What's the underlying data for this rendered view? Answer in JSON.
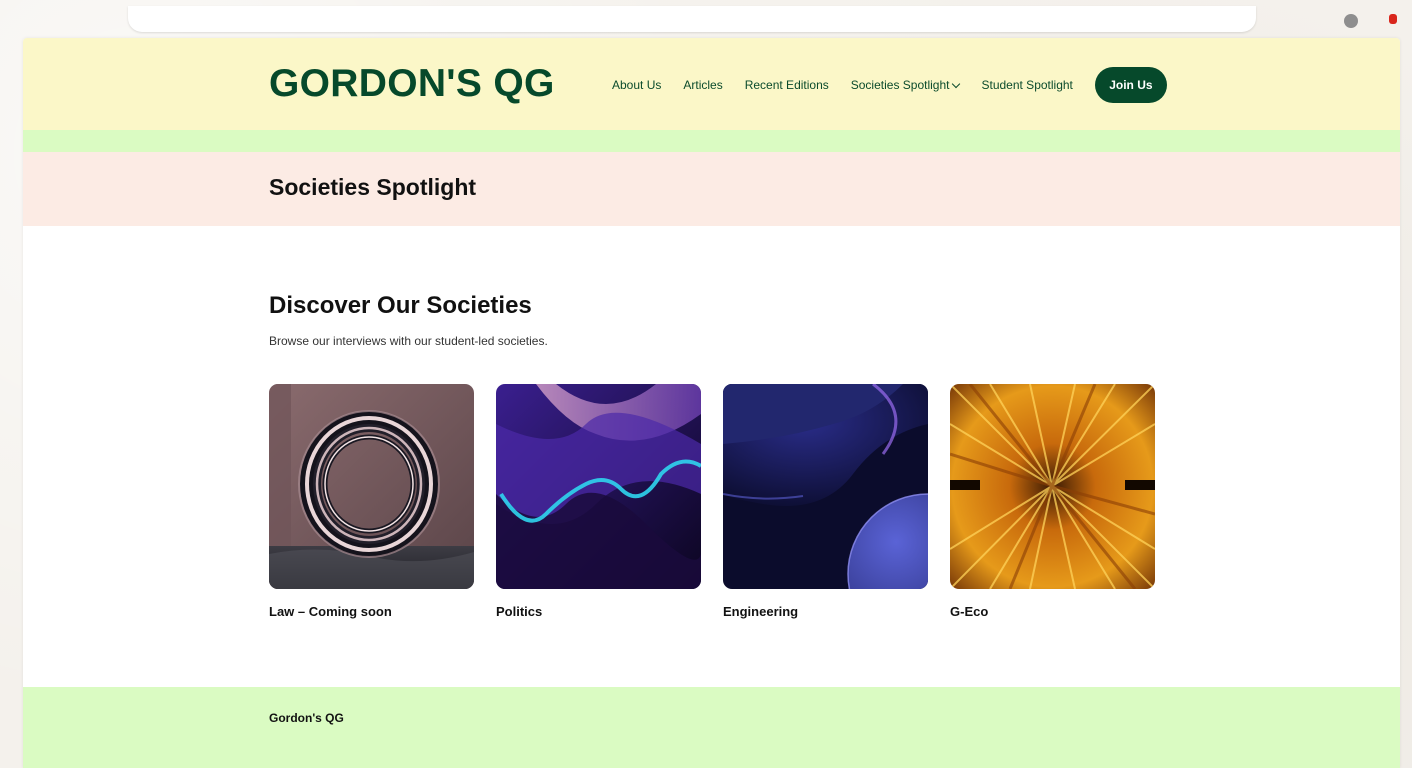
{
  "header": {
    "logo": "GORDON'S QG",
    "nav": [
      {
        "label": "About Us"
      },
      {
        "label": "Articles"
      },
      {
        "label": "Recent Editions"
      },
      {
        "label": "Societies Spotlight"
      },
      {
        "label": "Student Spotlight"
      }
    ],
    "cta_label": "Join Us"
  },
  "page_title": "Societies Spotlight",
  "section": {
    "title": "Discover Our Societies",
    "subtitle": "Browse our interviews with our student-led societies."
  },
  "societies": [
    {
      "label": "Law – Coming soon",
      "image_icon": "ring-sculpture-image"
    },
    {
      "label": "Politics",
      "image_icon": "purple-waves-image"
    },
    {
      "label": "Engineering",
      "image_icon": "blue-spheres-image"
    },
    {
      "label": "G-Eco",
      "image_icon": "orange-burst-image"
    }
  ],
  "footer": {
    "site_name": "Gordon's QG"
  },
  "colors": {
    "brand_green": "#06492b",
    "header_bg": "#fbf7c8",
    "accent_green": "#dafbc2",
    "band_pink": "#fcebe4"
  }
}
